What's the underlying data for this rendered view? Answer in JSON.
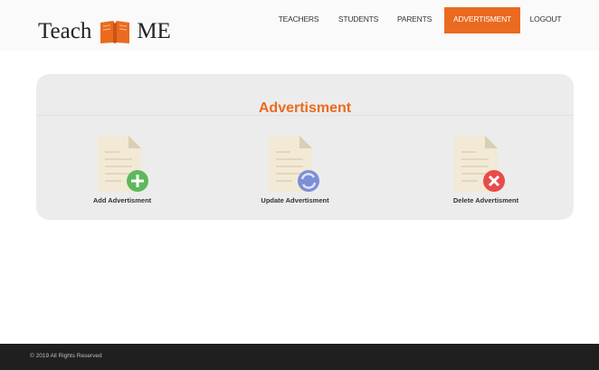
{
  "brand": {
    "word1": "Teach",
    "word2": "ME"
  },
  "nav": [
    {
      "label": "TEACHERS",
      "active": false
    },
    {
      "label": "STUDENTS",
      "active": false
    },
    {
      "label": "PARENTS",
      "active": false
    },
    {
      "label": "ADVERTISMENT",
      "active": true
    },
    {
      "label": "LOGOUT",
      "active": false
    }
  ],
  "panel": {
    "title": "Advertisment",
    "actions": [
      {
        "label": "Add Advertisment",
        "icon": "add-icon"
      },
      {
        "label": "Update Advertisment",
        "icon": "refresh-icon"
      },
      {
        "label": "Delete Advertisment",
        "icon": "delete-icon"
      }
    ]
  },
  "footer": {
    "copyright": "© 2019 All Rights Reserved"
  },
  "colors": {
    "accent": "#ea6a1f",
    "add": "#5cb85c",
    "update": "#7c8fd6",
    "delete": "#e94b4b",
    "footer_bg": "#1f1f1f"
  }
}
